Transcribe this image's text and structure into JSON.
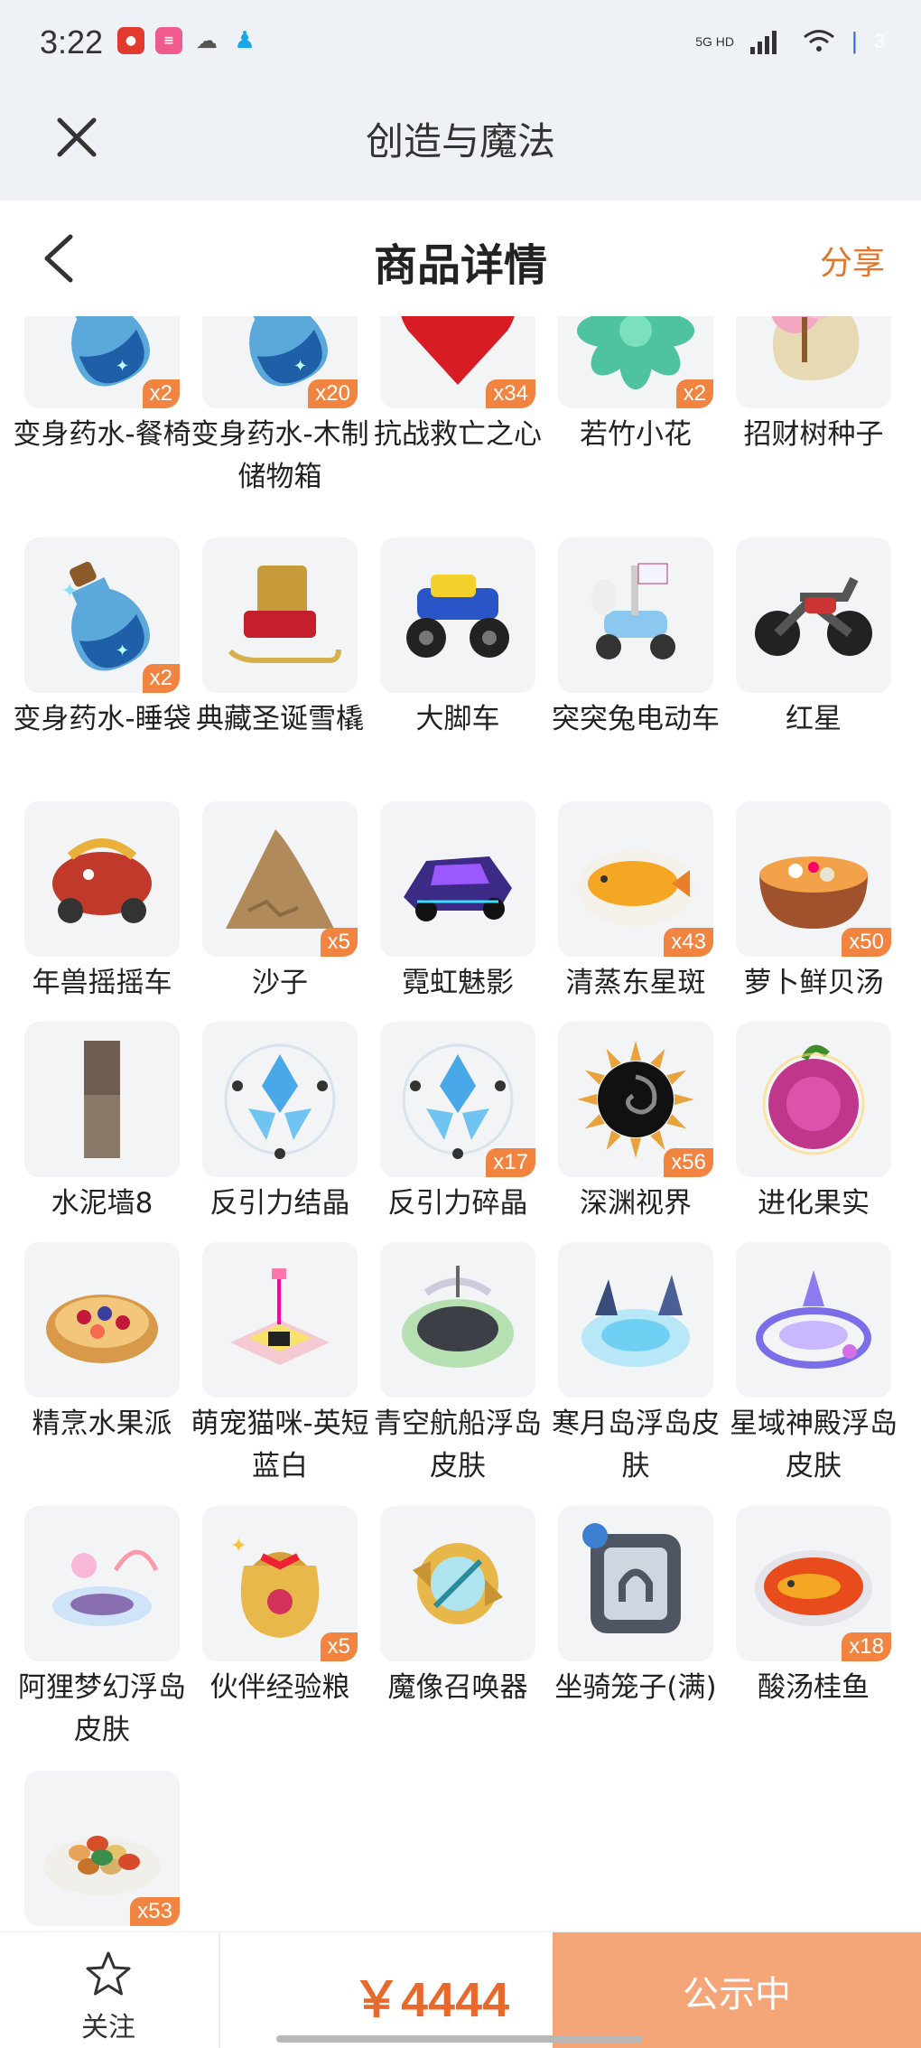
{
  "status_bar": {
    "time": "3:22",
    "network": "5G HD",
    "battery": "3"
  },
  "topbar": {
    "title": "创造与魔法"
  },
  "navbar": {
    "title": "商品详情",
    "share": "分享"
  },
  "items": [
    {
      "name": "变身药水-餐椅",
      "badge": "x2",
      "icon": "potion"
    },
    {
      "name": "变身药水-木制储物箱",
      "badge": "x20",
      "icon": "potion"
    },
    {
      "name": "抗战救亡之心",
      "badge": "x34",
      "icon": "heart"
    },
    {
      "name": "若竹小花",
      "badge": "x2",
      "icon": "succulent"
    },
    {
      "name": "招财树种子",
      "badge": "",
      "icon": "tree-seed"
    },
    {
      "name": "变身药水-睡袋",
      "badge": "x2",
      "icon": "potion"
    },
    {
      "name": "典藏圣诞雪橇",
      "badge": "",
      "icon": "sleigh"
    },
    {
      "name": "大脚车",
      "badge": "",
      "icon": "monster-truck"
    },
    {
      "name": "突突兔电动车",
      "badge": "",
      "icon": "scooter"
    },
    {
      "name": "红星",
      "badge": "",
      "icon": "motorcycle"
    },
    {
      "name": "年兽摇摇车",
      "badge": "",
      "icon": "nian-cart"
    },
    {
      "name": "沙子",
      "badge": "x5",
      "icon": "sand"
    },
    {
      "name": "霓虹魅影",
      "badge": "",
      "icon": "neon-car"
    },
    {
      "name": "清蒸东星斑",
      "badge": "x43",
      "icon": "fish-dish"
    },
    {
      "name": "萝卜鲜贝汤",
      "badge": "x50",
      "icon": "soup"
    },
    {
      "name": "水泥墙8",
      "badge": "",
      "icon": "wall"
    },
    {
      "name": "反引力结晶",
      "badge": "",
      "icon": "crystal"
    },
    {
      "name": "反引力碎晶",
      "badge": "x17",
      "icon": "crystal"
    },
    {
      "name": "深渊视界",
      "badge": "x56",
      "icon": "abyss"
    },
    {
      "name": "进化果实",
      "badge": "",
      "icon": "fruit"
    },
    {
      "name": "精烹水果派",
      "badge": "",
      "icon": "pie"
    },
    {
      "name": "萌宠猫咪-英短蓝白",
      "badge": "",
      "icon": "cat-house"
    },
    {
      "name": "青空航船浮岛皮肤",
      "badge": "",
      "icon": "island-stadium"
    },
    {
      "name": "寒月岛浮岛皮肤",
      "badge": "",
      "icon": "island-ice"
    },
    {
      "name": "星域神殿浮岛皮肤",
      "badge": "",
      "icon": "island-star"
    },
    {
      "name": "阿狸梦幻浮岛皮肤",
      "badge": "",
      "icon": "island-dream"
    },
    {
      "name": "伙伴经验粮",
      "badge": "x5",
      "icon": "food-bag"
    },
    {
      "name": "魔像召唤器",
      "badge": "",
      "icon": "summoner"
    },
    {
      "name": "坐骑笼子(满)",
      "badge": "",
      "icon": "cage"
    },
    {
      "name": "酸汤桂鱼",
      "badge": "x18",
      "icon": "fish-soup"
    },
    {
      "name": "",
      "badge": "x53",
      "icon": "nut-plate"
    }
  ],
  "bottom_bar": {
    "follow_label": "关注",
    "price": "￥4444",
    "status_label": "公示中"
  },
  "colors": {
    "accent": "#e8692c",
    "badge": "#f08440",
    "status_button": "#f5a679",
    "header_bg": "#eef1f5"
  }
}
